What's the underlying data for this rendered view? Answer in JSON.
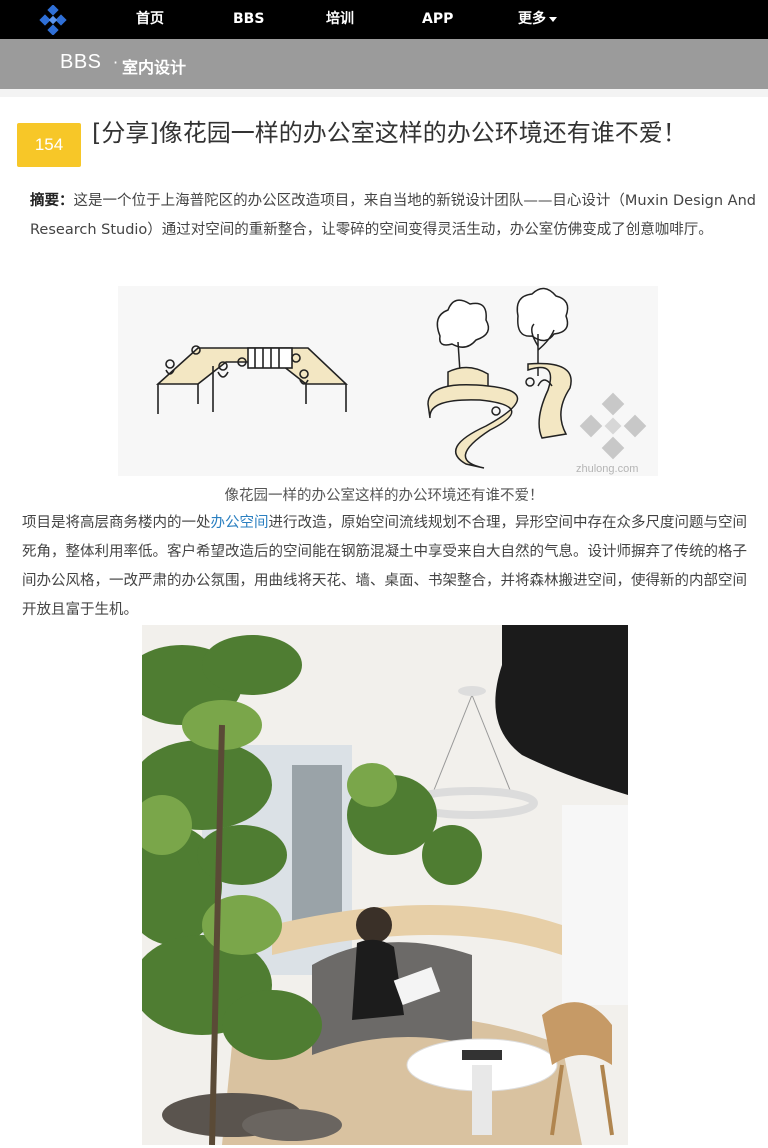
{
  "nav": {
    "logo": "diamond-logo-icon",
    "items": [
      "首页",
      "BBS",
      "培训",
      "APP",
      "更多"
    ]
  },
  "subheader": {
    "site": "BBS",
    "separator": "·",
    "category": "室内设计"
  },
  "post": {
    "count": "154",
    "title": "[分享]像花园一样的办公室这样的办公环境还有谁不爱！",
    "summary_label": "摘要：",
    "summary": "这是一个位于上海普陀区的办公区改造项目，来自当地的新锐设计团队——目心设计（Muxin Design And Research Studio）通过对空间的重新整合，让零碎的空间变得灵活生动，办公室仿佛变成了创意咖啡厅。",
    "image_caption": "像花园一样的办公室这样的办公环境还有谁不爱！",
    "watermark": "zhulong.com",
    "body_before_link": "项目是将高层商务楼内的一处",
    "body_link": "办公空间",
    "body_after_link": "进行改造，原始空间流线规划不合理，异形空间中存在众多尺度问题与空间死角，整体利用率低。客户希望改造后的空间能在钢筋混凝土中享受来自大自然的气息。设计师摒弃了传统的格子间办公风格，一改严肃的办公氛围，用曲线将天花、墙、桌面、书架整合，并将森林搬进空间，使得新的内部空间开放且富于生机。"
  },
  "colors": {
    "nav_bg": "#000000",
    "subheader_bg": "#9b9b9b",
    "badge": "#f7c728",
    "link": "#2a7fc0"
  }
}
